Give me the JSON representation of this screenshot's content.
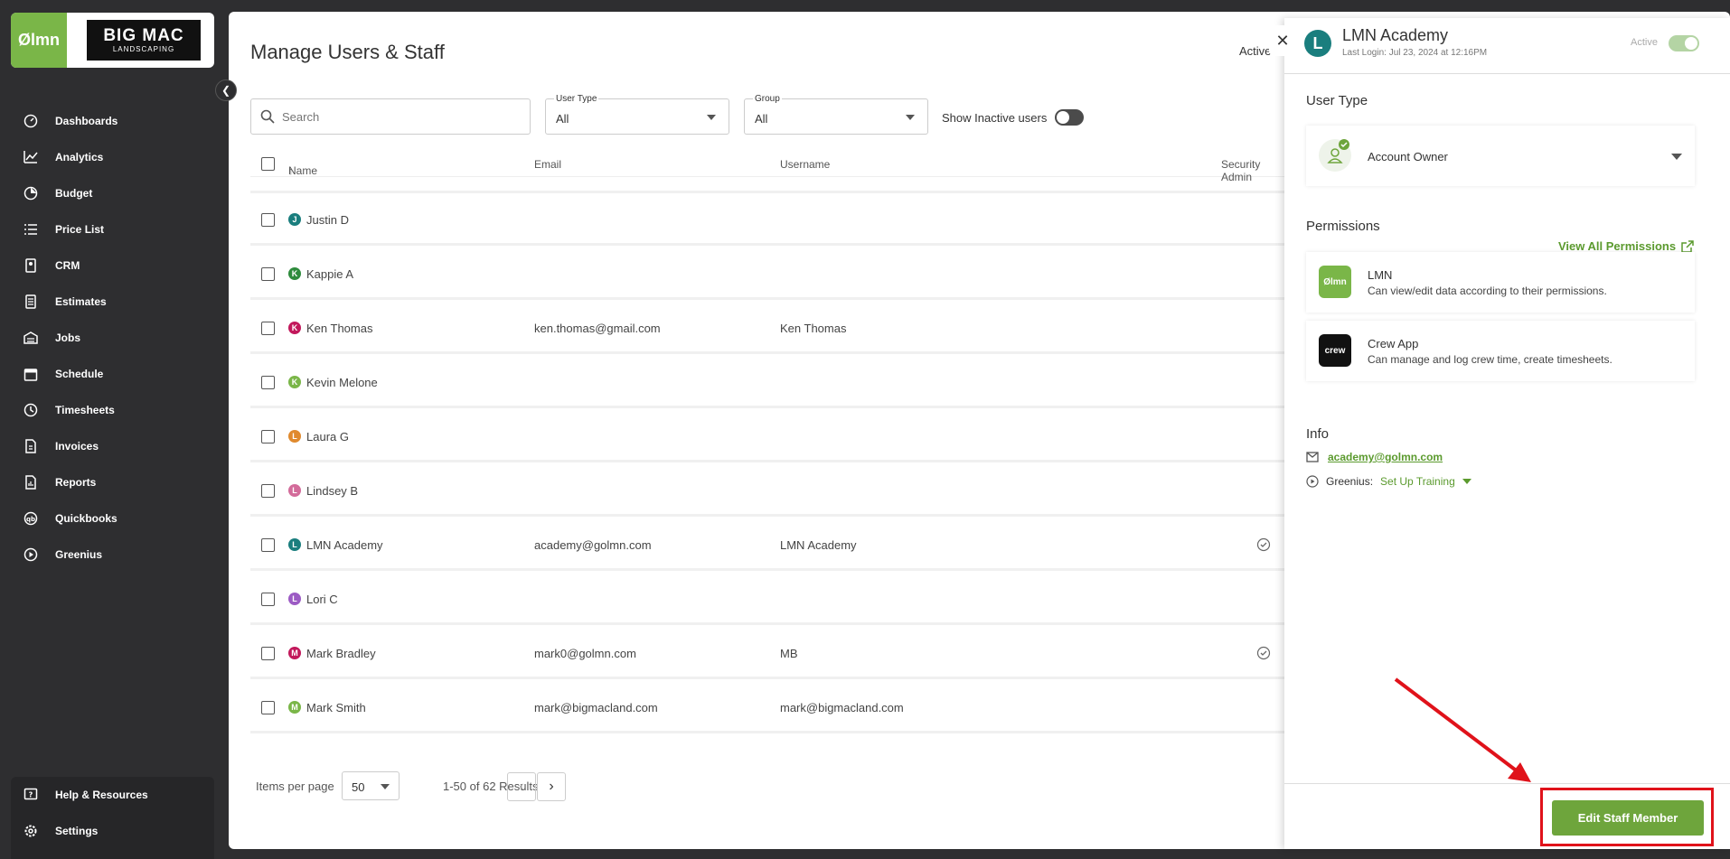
{
  "brand": {
    "logo_text": "Ølmn",
    "company_top": "BIG MAC",
    "company_bottom": "LANDSCAPING"
  },
  "nav": {
    "items": [
      {
        "label": "Dashboards",
        "icon": "dashboard-icon"
      },
      {
        "label": "Analytics",
        "icon": "analytics-icon"
      },
      {
        "label": "Budget",
        "icon": "budget-icon"
      },
      {
        "label": "Price List",
        "icon": "list-icon"
      },
      {
        "label": "CRM",
        "icon": "crm-icon"
      },
      {
        "label": "Estimates",
        "icon": "estimates-icon"
      },
      {
        "label": "Jobs",
        "icon": "jobs-icon"
      },
      {
        "label": "Schedule",
        "icon": "calendar-icon"
      },
      {
        "label": "Timesheets",
        "icon": "clock-icon"
      },
      {
        "label": "Invoices",
        "icon": "invoice-icon"
      },
      {
        "label": "Reports",
        "icon": "reports-icon"
      },
      {
        "label": "Quickbooks",
        "icon": "quickbooks-icon"
      },
      {
        "label": "Greenius",
        "icon": "play-icon"
      }
    ],
    "bottom": [
      {
        "label": "Help & Resources",
        "icon": "help-icon"
      },
      {
        "label": "Settings",
        "icon": "gear-icon"
      }
    ]
  },
  "main": {
    "title": "Manage Users & Staff",
    "active_label": "Active",
    "search_placeholder": "Search",
    "user_type": {
      "label": "User Type",
      "value": "All"
    },
    "group": {
      "label": "Group",
      "value": "All"
    },
    "show_inactive": "Show Inactive users",
    "columns": {
      "name": "Name",
      "email": "Email",
      "username": "Username",
      "security_admin": "Security Admin"
    },
    "rows": [
      {
        "initial": "J",
        "color": "#1a7e7e",
        "name": "Justin D",
        "email": "",
        "username": "",
        "admin": false
      },
      {
        "initial": "K",
        "color": "#2e8b3d",
        "name": "Kappie A",
        "email": "",
        "username": "",
        "admin": false
      },
      {
        "initial": "K",
        "color": "#c2185b",
        "name": "Ken Thomas",
        "email": "ken.thomas@gmail.com",
        "username": "Ken Thomas",
        "admin": false
      },
      {
        "initial": "K",
        "color": "#7ab648",
        "name": "Kevin Melone",
        "email": "",
        "username": "",
        "admin": false
      },
      {
        "initial": "L",
        "color": "#e08a2e",
        "name": "Laura G",
        "email": "",
        "username": "",
        "admin": false
      },
      {
        "initial": "L",
        "color": "#d36b9a",
        "name": "Lindsey B",
        "email": "",
        "username": "",
        "admin": false
      },
      {
        "initial": "L",
        "color": "#1a7e7e",
        "name": "LMN Academy",
        "email": "academy@golmn.com",
        "username": "LMN Academy",
        "admin": true
      },
      {
        "initial": "L",
        "color": "#9c5bc4",
        "name": "Lori C",
        "email": "",
        "username": "",
        "admin": false
      },
      {
        "initial": "M",
        "color": "#c2185b",
        "name": "Mark Bradley",
        "email": "mark0@golmn.com",
        "username": "MB",
        "admin": true
      },
      {
        "initial": "M",
        "color": "#7ab648",
        "name": "Mark Smith",
        "email": "mark@bigmacland.com",
        "username": "mark@bigmacland.com",
        "admin": false
      }
    ],
    "pager": {
      "items_per_page_label": "Items per page",
      "per_page": "50",
      "results": "1-50 of 62 Results"
    }
  },
  "drawer": {
    "initial": "L",
    "title": "LMN Academy",
    "last_login": "Last Login: Jul 23, 2024 at 12:16PM",
    "status": "Active",
    "user_type_title": "User Type",
    "user_type_value": "Account Owner",
    "permissions_title": "Permissions",
    "view_all": "View All Permissions",
    "permissions": [
      {
        "name": "LMN",
        "desc": "Can view/edit data according to their permissions.",
        "icon_text": "Ølmn",
        "color": "#7ab648"
      },
      {
        "name": "Crew App",
        "desc": "Can manage and log crew time, create timesheets.",
        "icon_text": "crew",
        "color": "#111111"
      }
    ],
    "info_title": "Info",
    "email": "academy@golmn.com",
    "greenius_label": "Greenius:",
    "greenius_link": "Set Up Training",
    "edit_button": "Edit Staff Member"
  }
}
